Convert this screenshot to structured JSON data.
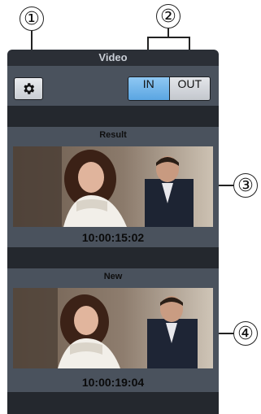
{
  "callouts": [
    "①",
    "②",
    "③",
    "④"
  ],
  "panel": {
    "title": "Video",
    "toolbar": {
      "settings_icon": "gear-icon",
      "in_label": "IN",
      "out_label": "OUT",
      "active": "IN"
    },
    "previews": [
      {
        "label": "Result",
        "timecode": "10:00:15:02"
      },
      {
        "label": "New",
        "timecode": "10:00:19:04"
      }
    ]
  },
  "colors": {
    "panel_bg": "#2b2f36",
    "toolbar_bg": "#4a525d",
    "active_toggle": "#5aa5e2"
  }
}
